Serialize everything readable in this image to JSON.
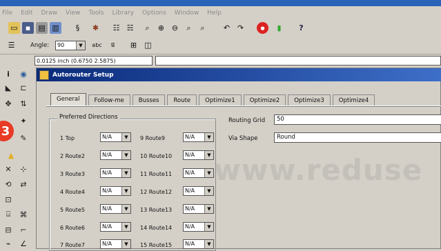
{
  "menu": [
    "File",
    "Edit",
    "Draw",
    "View",
    "Tools",
    "Library",
    "Options",
    "Window",
    "Help"
  ],
  "toolbar": {
    "icons": [
      "open-icon",
      "save-icon",
      "print-icon",
      "export-icon",
      "snap-icon",
      "component-icon",
      "grid-icon",
      "grid-alt-icon",
      "zoom-icon",
      "zoom-in-icon",
      "zoom-out-icon",
      "zoom-fit-icon",
      "zoom-area-icon",
      "undo-icon",
      "redo-icon",
      "stop-icon",
      "battery-icon",
      "help-icon"
    ],
    "help_glyph": "?"
  },
  "toolbar2": {
    "angle_label": "Angle:",
    "angle_value": "90"
  },
  "coords": {
    "value": "0.0125 inch (0.6750 2.5875)"
  },
  "badge": {
    "number": "3"
  },
  "dialog": {
    "title": "Autorouter Setup",
    "tabs": [
      "General",
      "Follow-me",
      "Busses",
      "Route",
      "Optimize1",
      "Optimize2",
      "Optimize3",
      "Optimize4"
    ],
    "group_label": "Preferred Directions",
    "directions_left": [
      {
        "label": "1 Top",
        "value": "N/A"
      },
      {
        "label": "2 Route2",
        "value": "N/A"
      },
      {
        "label": "3 Route3",
        "value": "N/A"
      },
      {
        "label": "4 Route4",
        "value": "N/A"
      },
      {
        "label": "5 Route5",
        "value": "N/A"
      },
      {
        "label": "6 Route6",
        "value": "N/A"
      },
      {
        "label": "7 Route7",
        "value": "N/A"
      }
    ],
    "directions_right": [
      {
        "label": "9 Route9",
        "value": "N/A"
      },
      {
        "label": "10 Route10",
        "value": "N/A"
      },
      {
        "label": "11 Route11",
        "value": "N/A"
      },
      {
        "label": "12 Route12",
        "value": "N/A"
      },
      {
        "label": "13 Route13",
        "value": "N/A"
      },
      {
        "label": "14 Route14",
        "value": "N/A"
      },
      {
        "label": "15 Route15",
        "value": "N/A"
      }
    ],
    "routing_grid_label": "Routing Grid",
    "routing_grid_value": "50",
    "via_shape_label": "Via Shape",
    "via_shape_value": "Round"
  },
  "watermark": "www.reduse"
}
